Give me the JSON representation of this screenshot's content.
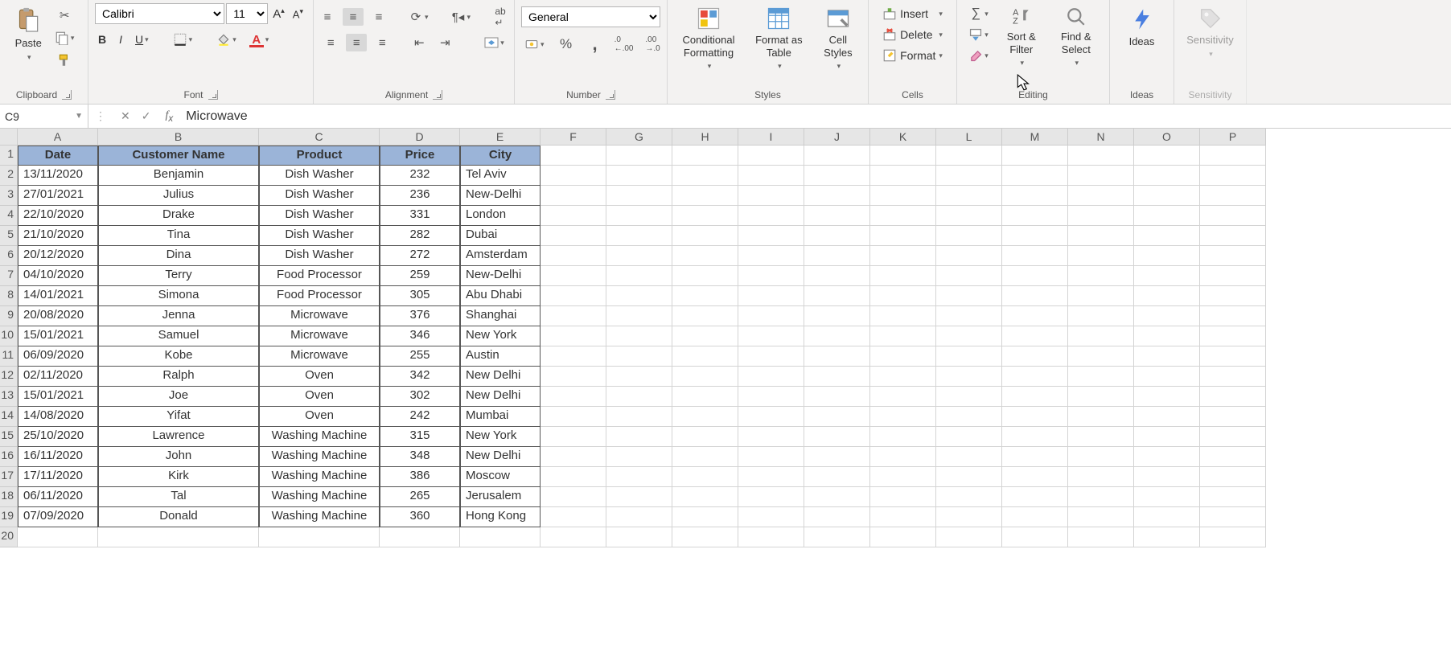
{
  "ribbon": {
    "clipboard": {
      "paste": "Paste",
      "label": "Clipboard"
    },
    "font": {
      "name": "Calibri",
      "size": "11",
      "label": "Font",
      "bold": "B",
      "italic": "I",
      "underline": "U"
    },
    "alignment": {
      "label": "Alignment"
    },
    "number": {
      "format": "General",
      "label": "Number"
    },
    "styles": {
      "conditional": "Conditional Formatting",
      "formatAs": "Format as Table",
      "cell": "Cell Styles",
      "label": "Styles"
    },
    "cells": {
      "insert": "Insert",
      "delete": "Delete",
      "format": "Format",
      "label": "Cells"
    },
    "editing": {
      "sort": "Sort & Filter",
      "find": "Find & Select",
      "label": "Editing"
    },
    "ideas": {
      "ideas": "Ideas",
      "label": "Ideas"
    },
    "sensitivity": {
      "sensitivity": "Sensitivity",
      "label": "Sensitivity"
    }
  },
  "formulaBar": {
    "nameBox": "C9",
    "value": "Microwave"
  },
  "columns": [
    "A",
    "B",
    "C",
    "D",
    "E",
    "F",
    "G",
    "H",
    "I",
    "J",
    "K",
    "L",
    "M",
    "N",
    "O",
    "P"
  ],
  "headers": [
    "Date",
    "Customer Name",
    "Product",
    "Price",
    "City"
  ],
  "rows": [
    [
      "13/11/2020",
      "Benjamin",
      "Dish Washer",
      "232",
      "Tel Aviv"
    ],
    [
      "27/01/2021",
      "Julius",
      "Dish Washer",
      "236",
      "New-Delhi"
    ],
    [
      "22/10/2020",
      "Drake",
      "Dish Washer",
      "331",
      "London"
    ],
    [
      "21/10/2020",
      "Tina",
      "Dish Washer",
      "282",
      "Dubai"
    ],
    [
      "20/12/2020",
      "Dina",
      "Dish Washer",
      "272",
      "Amsterdam"
    ],
    [
      "04/10/2020",
      "Terry",
      "Food Processor",
      "259",
      "New-Delhi"
    ],
    [
      "14/01/2021",
      "Simona",
      "Food Processor",
      "305",
      "Abu Dhabi"
    ],
    [
      "20/08/2020",
      "Jenna",
      "Microwave",
      "376",
      "Shanghai"
    ],
    [
      "15/01/2021",
      "Samuel",
      "Microwave",
      "346",
      "New York"
    ],
    [
      "06/09/2020",
      "Kobe",
      "Microwave",
      "255",
      "Austin"
    ],
    [
      "02/11/2020",
      "Ralph",
      "Oven",
      "342",
      "New Delhi"
    ],
    [
      "15/01/2021",
      "Joe",
      "Oven",
      "302",
      "New Delhi"
    ],
    [
      "14/08/2020",
      "Yifat",
      "Oven",
      "242",
      "Mumbai"
    ],
    [
      "25/10/2020",
      "Lawrence",
      "Washing Machine",
      "315",
      "New York"
    ],
    [
      "16/11/2020",
      "John",
      "Washing Machine",
      "348",
      "New Delhi"
    ],
    [
      "17/11/2020",
      "Kirk",
      "Washing Machine",
      "386",
      "Moscow"
    ],
    [
      "06/11/2020",
      "Tal",
      "Washing Machine",
      "265",
      "Jerusalem"
    ],
    [
      "07/09/2020",
      "Donald",
      "Washing Machine",
      "360",
      "Hong Kong"
    ]
  ]
}
